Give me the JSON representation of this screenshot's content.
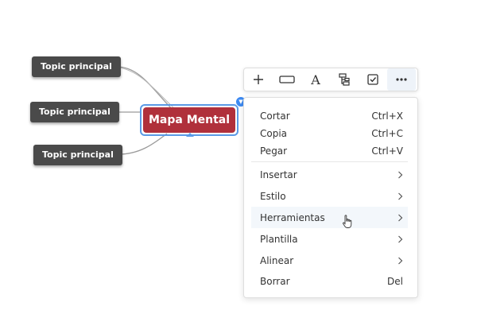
{
  "mindmap": {
    "central_topic": "Mapa Mental",
    "topics": [
      "Topic principal",
      "Topic principal",
      "Topic principal"
    ]
  },
  "toolbar": {
    "tools": [
      "plus-icon",
      "rectangle-icon",
      "text-icon",
      "structure-icon",
      "checkbox-icon",
      "more-icon"
    ],
    "font_glyph": "A",
    "more_glyph": "•••"
  },
  "context_menu": {
    "cut": {
      "label": "Cortar",
      "shortcut": "Ctrl+X"
    },
    "copy": {
      "label": "Copia",
      "shortcut": "Ctrl+C"
    },
    "paste": {
      "label": "Pegar",
      "shortcut": "Ctrl+V"
    },
    "insert": {
      "label": "Insertar"
    },
    "style": {
      "label": "Estilo"
    },
    "tools": {
      "label": "Herramientas"
    },
    "template": {
      "label": "Plantilla"
    },
    "align": {
      "label": "Alinear"
    },
    "delete": {
      "label": "Borrar",
      "shortcut": "Del"
    }
  },
  "colors": {
    "central_fill": "#b0303b",
    "selection": "#5b9ae6",
    "topic_fill": "#4a4a4a"
  }
}
